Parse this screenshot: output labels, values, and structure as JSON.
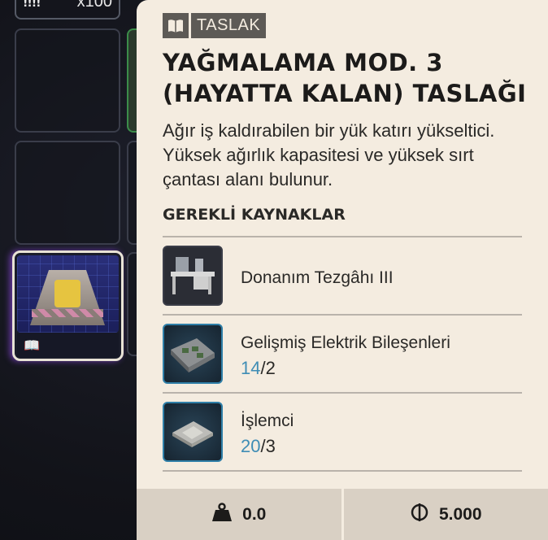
{
  "inventory": {
    "top_slot": {
      "bars": "!!!!",
      "quantity": "x100"
    }
  },
  "tag": {
    "icon": "book-icon",
    "label": "TASLAK"
  },
  "item": {
    "title": "YAĞMALAMA MOD. 3 (HAYATTA KALAN) TASLAĞI",
    "description": "Ağır iş kaldırabilen bir yük katırı yükseltici. Yüksek ağırlık kapasitesi ve yüksek sırt çantası alanı bulunur."
  },
  "section_title": "GEREKLİ KAYNAKLAR",
  "resources": [
    {
      "name": "Donanım Tezgâhı III",
      "icon": "workbench-icon"
    },
    {
      "name": "Gelişmiş Elektrik Bileşenleri",
      "have": "14",
      "need": "/2",
      "icon": "electric-components-icon"
    },
    {
      "name": "İşlemci",
      "have": "20",
      "need": "/3",
      "icon": "processor-icon"
    }
  ],
  "footer": {
    "weight": {
      "icon": "weight-icon",
      "value": "0.0"
    },
    "price": {
      "icon": "coin-icon",
      "value": "5.000"
    }
  },
  "colors": {
    "panel_bg": "#f4ece0",
    "accent_blue": "#3f8db5",
    "tag_bg": "#5d5a56"
  }
}
